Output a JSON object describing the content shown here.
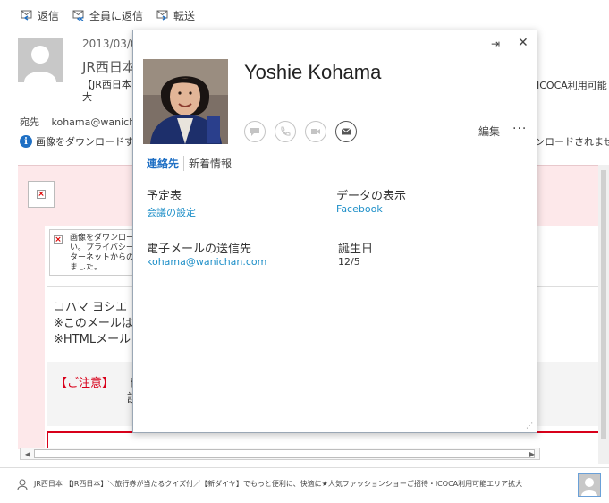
{
  "toolbar": {
    "reply": "返信",
    "reply_all": "全員に返信",
    "forward": "転送"
  },
  "message": {
    "date": "2013/03/0",
    "sender": "JR西日本",
    "subject_line1": "【JR西日本",
    "subject_line2": "大",
    "subject_right": "ICOCA利用可能",
    "to_label": "宛先",
    "to_address": "kohama@wanichan",
    "info_text": "画像をダウンロードする",
    "info_right": "ンロードされませ",
    "image_notice": "画像をダウンロードしてください。プライバシー…インターネットからの…ました。",
    "image_notice_lines": [
      "画像をダウンロー",
      "い。プライバシー",
      "ターネットからの",
      "ました。"
    ],
    "body_lines": [
      "コハマ ヨシエ さ",
      "※このメールは",
      "※HTMLメール"
    ],
    "caution_label": "【ご注意】",
    "caution_t1": "ト",
    "caution_t2": "該"
  },
  "people_bar": {
    "text": "JR西日本 【JR西日本】＼旅行券が当たるクイズ付／【新ダイヤ】でもっと便利に、快適に★人気ファッションショーご招待・ICOCA利用可能エリア拡大"
  },
  "contact_card": {
    "name": "Yoshie Kohama",
    "pin_glyph": "⇥",
    "close_glyph": "✕",
    "edit_label": "編集",
    "more_label": "···",
    "tabs": [
      {
        "label": "連絡先",
        "active": true
      },
      {
        "label": "新着情報",
        "active": false
      }
    ],
    "schedule_label": "予定表",
    "schedule_value": "会議の設定",
    "data_label": "データの表示",
    "data_value": "Facebook",
    "email_label": "電子メールの送信先",
    "email_value": "kohama@wanichan.com",
    "birthday_label": "誕生日",
    "birthday_value": "12/5"
  },
  "colors": {
    "accent": "#1e6fc4",
    "link": "#1e8fc8",
    "alert_red": "#d8001a",
    "pink_bg": "#fde8ea"
  }
}
